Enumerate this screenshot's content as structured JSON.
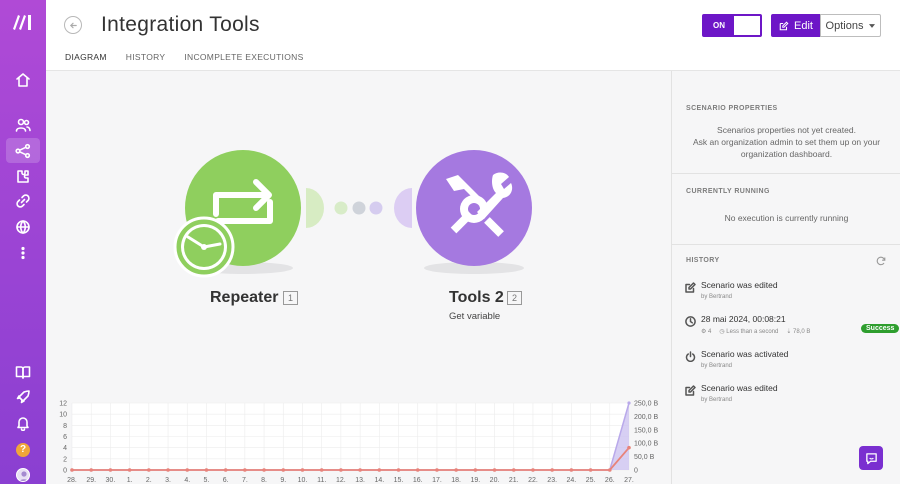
{
  "header": {
    "title": "Integration Tools",
    "toggle_label": "ON",
    "edit_label": "Edit",
    "options_label": "Options"
  },
  "tabs": [
    {
      "label": "DIAGRAM",
      "active": true
    },
    {
      "label": "HISTORY",
      "active": false
    },
    {
      "label": "INCOMPLETE EXECUTIONS",
      "active": false
    }
  ],
  "sidebar": {
    "icons": [
      "home-icon",
      "users-icon",
      "scenarios-icon",
      "apps-icon",
      "connections-icon",
      "webhooks-icon",
      "more-icon",
      "docs-icon",
      "launch-icon",
      "bell-icon",
      "help-icon",
      "avatar"
    ],
    "active": "scenarios-icon",
    "help_label": "?"
  },
  "modules": [
    {
      "name": "Repeater",
      "number": "1",
      "subtitle": "",
      "color": "#8fcf5e"
    },
    {
      "name": "Tools 2",
      "number": "2",
      "subtitle": "Get variable",
      "color": "#a579e0"
    }
  ],
  "panel": {
    "scenario_properties": {
      "title": "SCENARIO PROPERTIES",
      "line1": "Scenarios properties not yet created.",
      "line2": "Ask an organization admin to set them up on your",
      "line3": "organization dashboard."
    },
    "currently_running": {
      "title": "CURRENTLY RUNNING",
      "text": "No execution is currently running"
    },
    "history": {
      "title": "HISTORY",
      "items": [
        {
          "icon": "edit-icon",
          "title": "Scenario was edited",
          "by": "by Bertrand"
        },
        {
          "icon": "clock-icon",
          "title": "28 mai 2024, 00:08:21",
          "ops": "4",
          "duration": "Less than a second",
          "transfer": "78,0 B",
          "status": "Success"
        },
        {
          "icon": "power-icon",
          "title": "Scenario was activated",
          "by": "by Bertrand"
        },
        {
          "icon": "edit-icon",
          "title": "Scenario was edited",
          "by": "by Bertrand"
        }
      ]
    }
  },
  "chart_data": {
    "type": "line",
    "x": [
      "28.",
      "29.",
      "30.",
      "1.",
      "2.",
      "3.",
      "4.",
      "5.",
      "6.",
      "7.",
      "8.",
      "9.",
      "10.",
      "11.",
      "12.",
      "13.",
      "14.",
      "15.",
      "16.",
      "17.",
      "18.",
      "19.",
      "20.",
      "21.",
      "22.",
      "23.",
      "24.",
      "25.",
      "26.",
      "27."
    ],
    "series": [
      {
        "values": [
          0,
          0,
          0,
          0,
          0,
          0,
          0,
          0,
          0,
          0,
          0,
          0,
          0,
          0,
          0,
          0,
          0,
          0,
          0,
          0,
          0,
          0,
          0,
          0,
          0,
          0,
          0,
          0,
          0,
          4
        ],
        "color": "#e8837a"
      },
      {
        "values": [
          0,
          0,
          0,
          0,
          0,
          0,
          0,
          0,
          0,
          0,
          0,
          0,
          0,
          0,
          0,
          0,
          0,
          0,
          0,
          0,
          0,
          0,
          0,
          0,
          0,
          0,
          0,
          0,
          0,
          250
        ],
        "color": "#b9a9ea"
      }
    ],
    "y_left_ticks": [
      "0",
      "2",
      "4",
      "6",
      "8",
      "10",
      "12"
    ],
    "y_left_lim": [
      0,
      12
    ],
    "y_right_ticks": [
      "0",
      "50,0 B",
      "100,0 B",
      "150,0 B",
      "200,0 B",
      "250,0 B"
    ],
    "y_right_lim": [
      0,
      250
    ],
    "grid": true
  }
}
